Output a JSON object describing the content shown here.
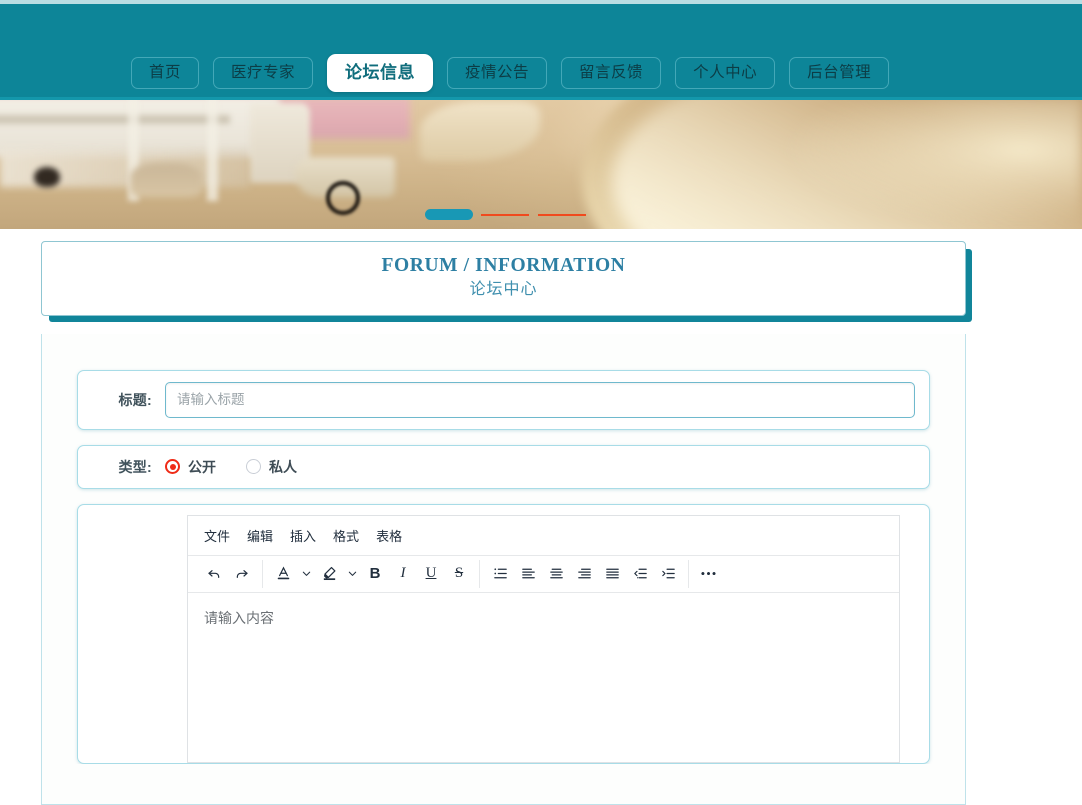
{
  "nav": {
    "tabs": [
      {
        "label": "首页",
        "name": "nav-tab-home",
        "active": false
      },
      {
        "label": "医疗专家",
        "name": "nav-tab-experts",
        "active": false
      },
      {
        "label": "论坛信息",
        "name": "nav-tab-forum",
        "active": true
      },
      {
        "label": "疫情公告",
        "name": "nav-tab-epidemic-notice",
        "active": false
      },
      {
        "label": "留言反馈",
        "name": "nav-tab-feedback",
        "active": false
      },
      {
        "label": "个人中心",
        "name": "nav-tab-personal-center",
        "active": false
      },
      {
        "label": "后台管理",
        "name": "nav-tab-admin",
        "active": false
      }
    ]
  },
  "banner": {
    "carousel": {
      "active_index": 0,
      "slide_count": 3
    }
  },
  "page_header": {
    "title_en": "FORUM / INFORMATION",
    "title_cn": "论坛中心"
  },
  "form": {
    "title_field": {
      "label": "标题:",
      "value": "",
      "placeholder": "请输入标题"
    },
    "type_field": {
      "label": "类型:",
      "options": [
        {
          "label": "公开",
          "selected": true
        },
        {
          "label": "私人",
          "selected": false
        }
      ]
    },
    "content_field": {
      "placeholder": "请输入内容"
    }
  },
  "editor": {
    "menubar": [
      "文件",
      "编辑",
      "插入",
      "格式",
      "表格"
    ],
    "toolbar": [
      {
        "name": "undo-icon",
        "title": "撤销"
      },
      {
        "name": "redo-icon",
        "title": "重做"
      },
      {
        "name": "text-color-icon",
        "title": "文本颜色"
      },
      {
        "name": "chevron-down-icon",
        "title": "文本颜色选项"
      },
      {
        "name": "highlight-color-icon",
        "title": "背景颜色"
      },
      {
        "name": "chevron-down-icon",
        "title": "背景颜色选项"
      },
      {
        "name": "bold-icon",
        "title": "粗体",
        "glyph": "B"
      },
      {
        "name": "italic-icon",
        "title": "斜体",
        "glyph": "I"
      },
      {
        "name": "underline-icon",
        "title": "下划线",
        "glyph": "U"
      },
      {
        "name": "strikethrough-icon",
        "title": "删除线",
        "glyph": "S"
      },
      {
        "name": "bullet-list-icon",
        "title": "项目符号"
      },
      {
        "name": "align-left-icon",
        "title": "左对齐"
      },
      {
        "name": "align-center-icon",
        "title": "居中对齐"
      },
      {
        "name": "align-right-icon",
        "title": "右对齐"
      },
      {
        "name": "align-justify-icon",
        "title": "两端对齐"
      },
      {
        "name": "outdent-icon",
        "title": "减少缩进"
      },
      {
        "name": "indent-icon",
        "title": "增加缩进"
      },
      {
        "name": "more-options-icon",
        "title": "更多",
        "glyph": "•••"
      }
    ]
  },
  "colors": {
    "brand_teal": "#0d8598",
    "banner_line": "#1497ab",
    "title_text": "#2d7fa3",
    "card_border": "#a8dce7",
    "radio_selected": "#ef2b17",
    "carousel_active": "#1898b5",
    "carousel_line": "#f04a1e"
  }
}
